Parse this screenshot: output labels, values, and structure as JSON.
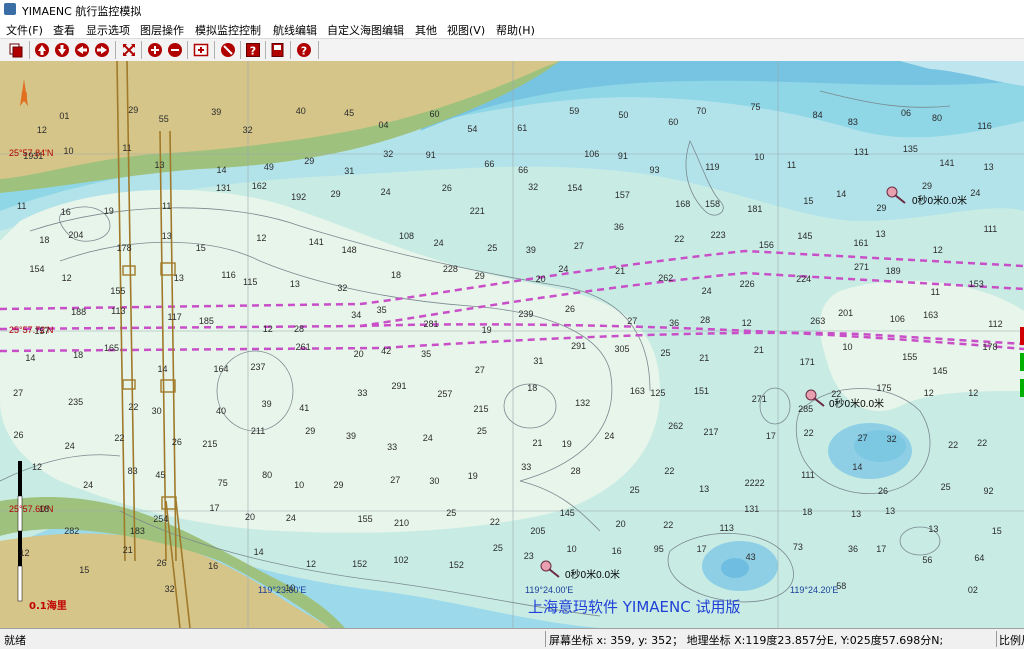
{
  "window": {
    "title": "YIMAENC 航行监控模拟"
  },
  "menu": [
    "文件(F)",
    "查看",
    "显示选项",
    "图层操作",
    "模拟监控控制",
    "航线编辑",
    "自定义海图编辑",
    "其他",
    "视图(V)",
    "帮助(H)"
  ],
  "toolbar": [
    {
      "name": "layers-icon",
      "color": "#b00000"
    },
    {
      "name": "pan-up-icon",
      "color": "#b00000"
    },
    {
      "name": "pan-down-icon",
      "color": "#b00000"
    },
    {
      "name": "pan-left-icon",
      "color": "#b00000"
    },
    {
      "name": "pan-right-icon",
      "color": "#b00000"
    },
    {
      "name": "fit-all-icon",
      "color": "#b00000"
    },
    {
      "name": "zoom-in-icon",
      "color": "#b00000"
    },
    {
      "name": "zoom-out-icon",
      "color": "#b00000"
    },
    {
      "name": "zoom-window-icon",
      "color": "#b00000"
    },
    {
      "name": "stop-icon",
      "color": "#b00000"
    },
    {
      "name": "question-box-icon",
      "color": "#b00000"
    },
    {
      "name": "book-icon",
      "color": "#b00000"
    },
    {
      "name": "help-icon",
      "color": "#b00000"
    }
  ],
  "chart": {
    "north_label": "N",
    "lat_labels": [
      "25°57.84'N",
      "25°57.72'N",
      "25°57.60'N"
    ],
    "lon_labels": [
      "119°23.80'E",
      "119°24.00'E",
      "119°24.20'E"
    ],
    "scale_label": "0.1海里",
    "watermark": "上海意玛软件 YIMAENC 试用版",
    "current_labels": [
      "0秒0米0.0米",
      "0秒0米0.0米",
      "0秒0米0.0米"
    ],
    "depth_soundings": [
      "12",
      "01",
      "29",
      "55",
      "39",
      "32",
      "40",
      "45",
      "04",
      "60",
      "54",
      "61",
      "59",
      "50",
      "60",
      "70",
      "75",
      "84",
      "83",
      "06",
      "80",
      "116",
      "1931",
      "10",
      "11",
      "13",
      "14",
      "49",
      "29",
      "31",
      "32",
      "91",
      "66",
      "66",
      "106",
      "91",
      "93",
      "119",
      "10",
      "11",
      "131",
      "135",
      "141",
      "13",
      "11",
      "16",
      "19",
      "11",
      "131",
      "162",
      "192",
      "29",
      "24",
      "26",
      "221",
      "32",
      "154",
      "157",
      "168",
      "158",
      "181",
      "15",
      "14",
      "29",
      "29",
      "24",
      "18",
      "204",
      "178",
      "13",
      "15",
      "12",
      "141",
      "148",
      "108",
      "24",
      "25",
      "39",
      "27",
      "36",
      "22",
      "223",
      "156",
      "145",
      "161",
      "13",
      "12",
      "111",
      "154",
      "12",
      "155",
      "13",
      "116",
      "115",
      "13",
      "32",
      "18",
      "228",
      "29",
      "20",
      "24",
      "21",
      "262",
      "24",
      "226",
      "224",
      "271",
      "189",
      "11",
      "153",
      "157",
      "188",
      "113",
      "117",
      "185",
      "12",
      "28",
      "34",
      "35",
      "281",
      "19",
      "239",
      "26",
      "27",
      "36",
      "28",
      "12",
      "263",
      "201",
      "106",
      "163",
      "112",
      "14",
      "18",
      "165",
      "14",
      "164",
      "237",
      "261",
      "20",
      "42",
      "35",
      "27",
      "31",
      "291",
      "305",
      "25",
      "21",
      "21",
      "171",
      "10",
      "155",
      "145",
      "178",
      "27",
      "235",
      "22",
      "30",
      "40",
      "39",
      "41",
      "33",
      "291",
      "257",
      "215",
      "18",
      "132",
      "163",
      "125",
      "151",
      "271",
      "285",
      "22",
      "175",
      "12",
      "12",
      "26",
      "24",
      "22",
      "26",
      "215",
      "211",
      "29",
      "39",
      "33",
      "24",
      "25",
      "21",
      "19",
      "24",
      "262",
      "217",
      "17",
      "22",
      "27",
      "32",
      "22",
      "22",
      "12",
      "24",
      "83",
      "45",
      "75",
      "80",
      "10",
      "29",
      "27",
      "30",
      "19",
      "33",
      "28",
      "25",
      "22",
      "13",
      "2222",
      "111",
      "14",
      "26",
      "25",
      "92",
      "18",
      "282",
      "183",
      "254",
      "17",
      "20",
      "24",
      "155",
      "210",
      "25",
      "22",
      "205",
      "145",
      "20",
      "22",
      "113",
      "131",
      "18",
      "13",
      "13",
      "13",
      "15",
      "12",
      "15",
      "21",
      "26",
      "16",
      "14",
      "12",
      "152",
      "102",
      "152",
      "25",
      "23",
      "10",
      "16",
      "95",
      "17",
      "43",
      "73",
      "36",
      "17",
      "56",
      "64",
      "75",
      "84",
      "95",
      "32",
      "15",
      "35",
      "10",
      "14",
      "91",
      "85",
      "93",
      "65",
      "23",
      "11",
      "56",
      "17",
      "13",
      "35",
      "58",
      "19",
      "71",
      "02",
      "82",
      "93",
      "53",
      "21",
      "13",
      "18",
      "13",
      "16",
      "14",
      "11",
      "13",
      "151",
      "113",
      "73",
      "98",
      "59",
      "05",
      "22",
      "12",
      "11",
      "25",
      "26",
      "12",
      "14",
      "13"
    ]
  },
  "status": {
    "ready": "就绪",
    "coords": "屏幕坐标 x: 359, y: 352；  地理坐标 X:119度23.857分E, Y:025度57.698分N;",
    "scale": "比例尺"
  }
}
